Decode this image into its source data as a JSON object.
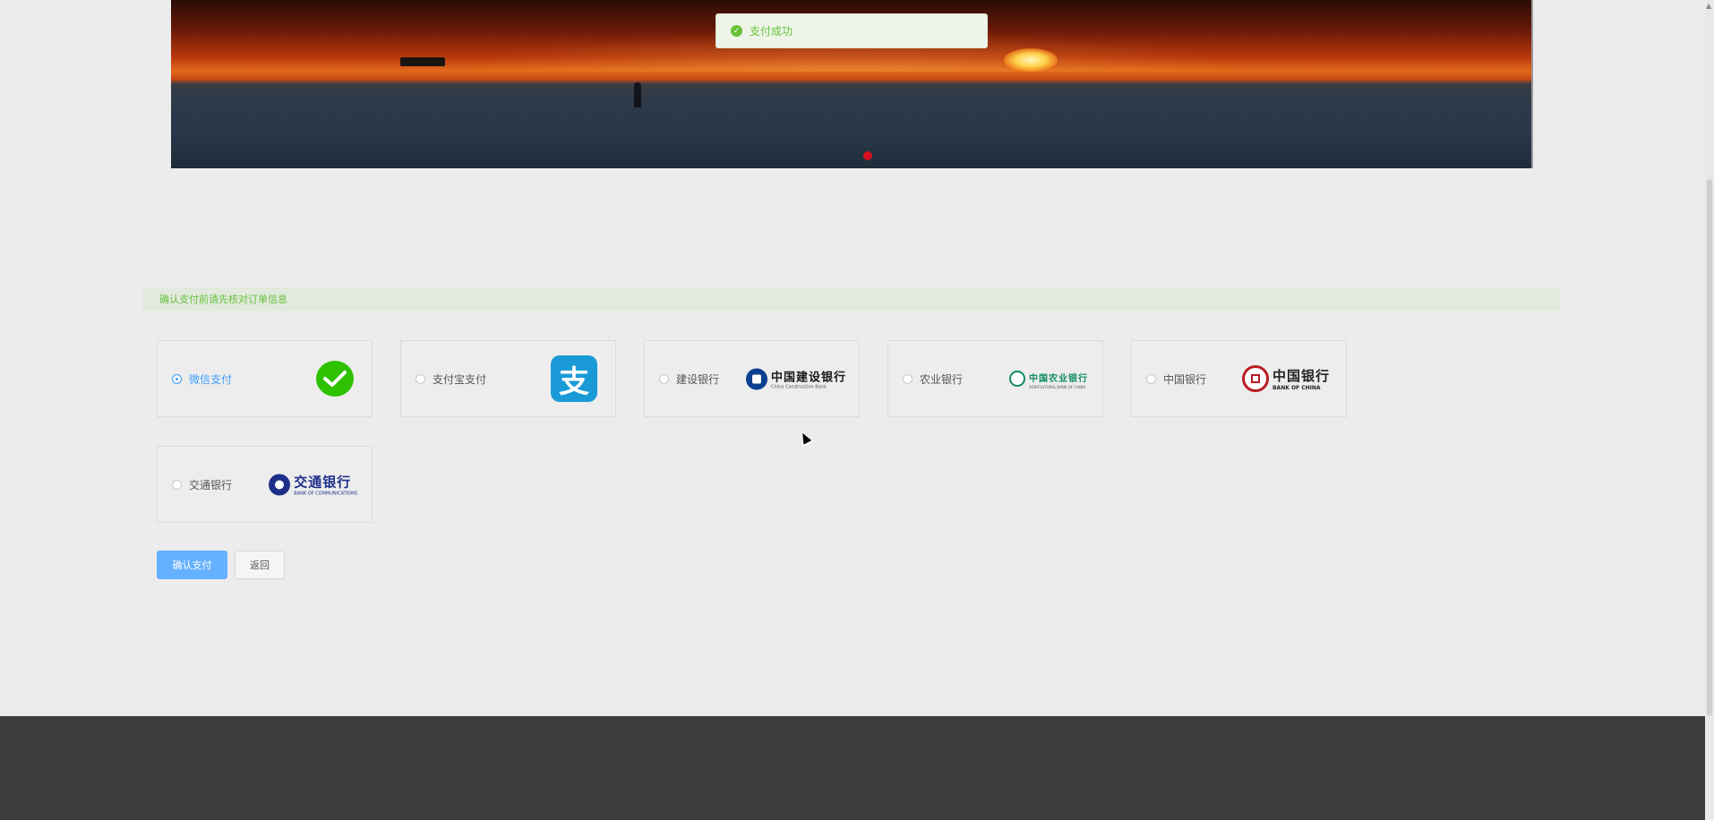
{
  "toast": {
    "message": "支付成功",
    "icon": "check-circle-icon",
    "color": "#67c23a"
  },
  "notice": {
    "text": "确认支付前请先核对订单信息"
  },
  "payment_methods": [
    {
      "label": "微信支付",
      "selected": true,
      "logo": "wechat-pay-logo"
    },
    {
      "label": "支付宝支付",
      "selected": false,
      "logo": "alipay-logo",
      "logo_text": "支"
    },
    {
      "label": "建设银行",
      "selected": false,
      "logo": "ccb-logo",
      "logo_cn": "中国建设银行",
      "logo_en": "China Construction Bank"
    },
    {
      "label": "农业银行",
      "selected": false,
      "logo": "abc-logo",
      "logo_cn": "中国农业银行",
      "logo_en": "AGRICULTURAL BANK OF CHINA"
    },
    {
      "label": "中国银行",
      "selected": false,
      "logo": "boc-logo",
      "logo_cn": "中国银行",
      "logo_en": "BANK OF CHINA"
    },
    {
      "label": "交通银行",
      "selected": false,
      "logo": "bocom-logo",
      "logo_cn": "交通银行",
      "logo_en": "BANK OF COMMUNICATIONS"
    }
  ],
  "buttons": {
    "confirm": "确认支付",
    "back": "返回"
  },
  "colors": {
    "primary": "#409eff",
    "success": "#67c23a",
    "footer": "#3c3c3c"
  }
}
